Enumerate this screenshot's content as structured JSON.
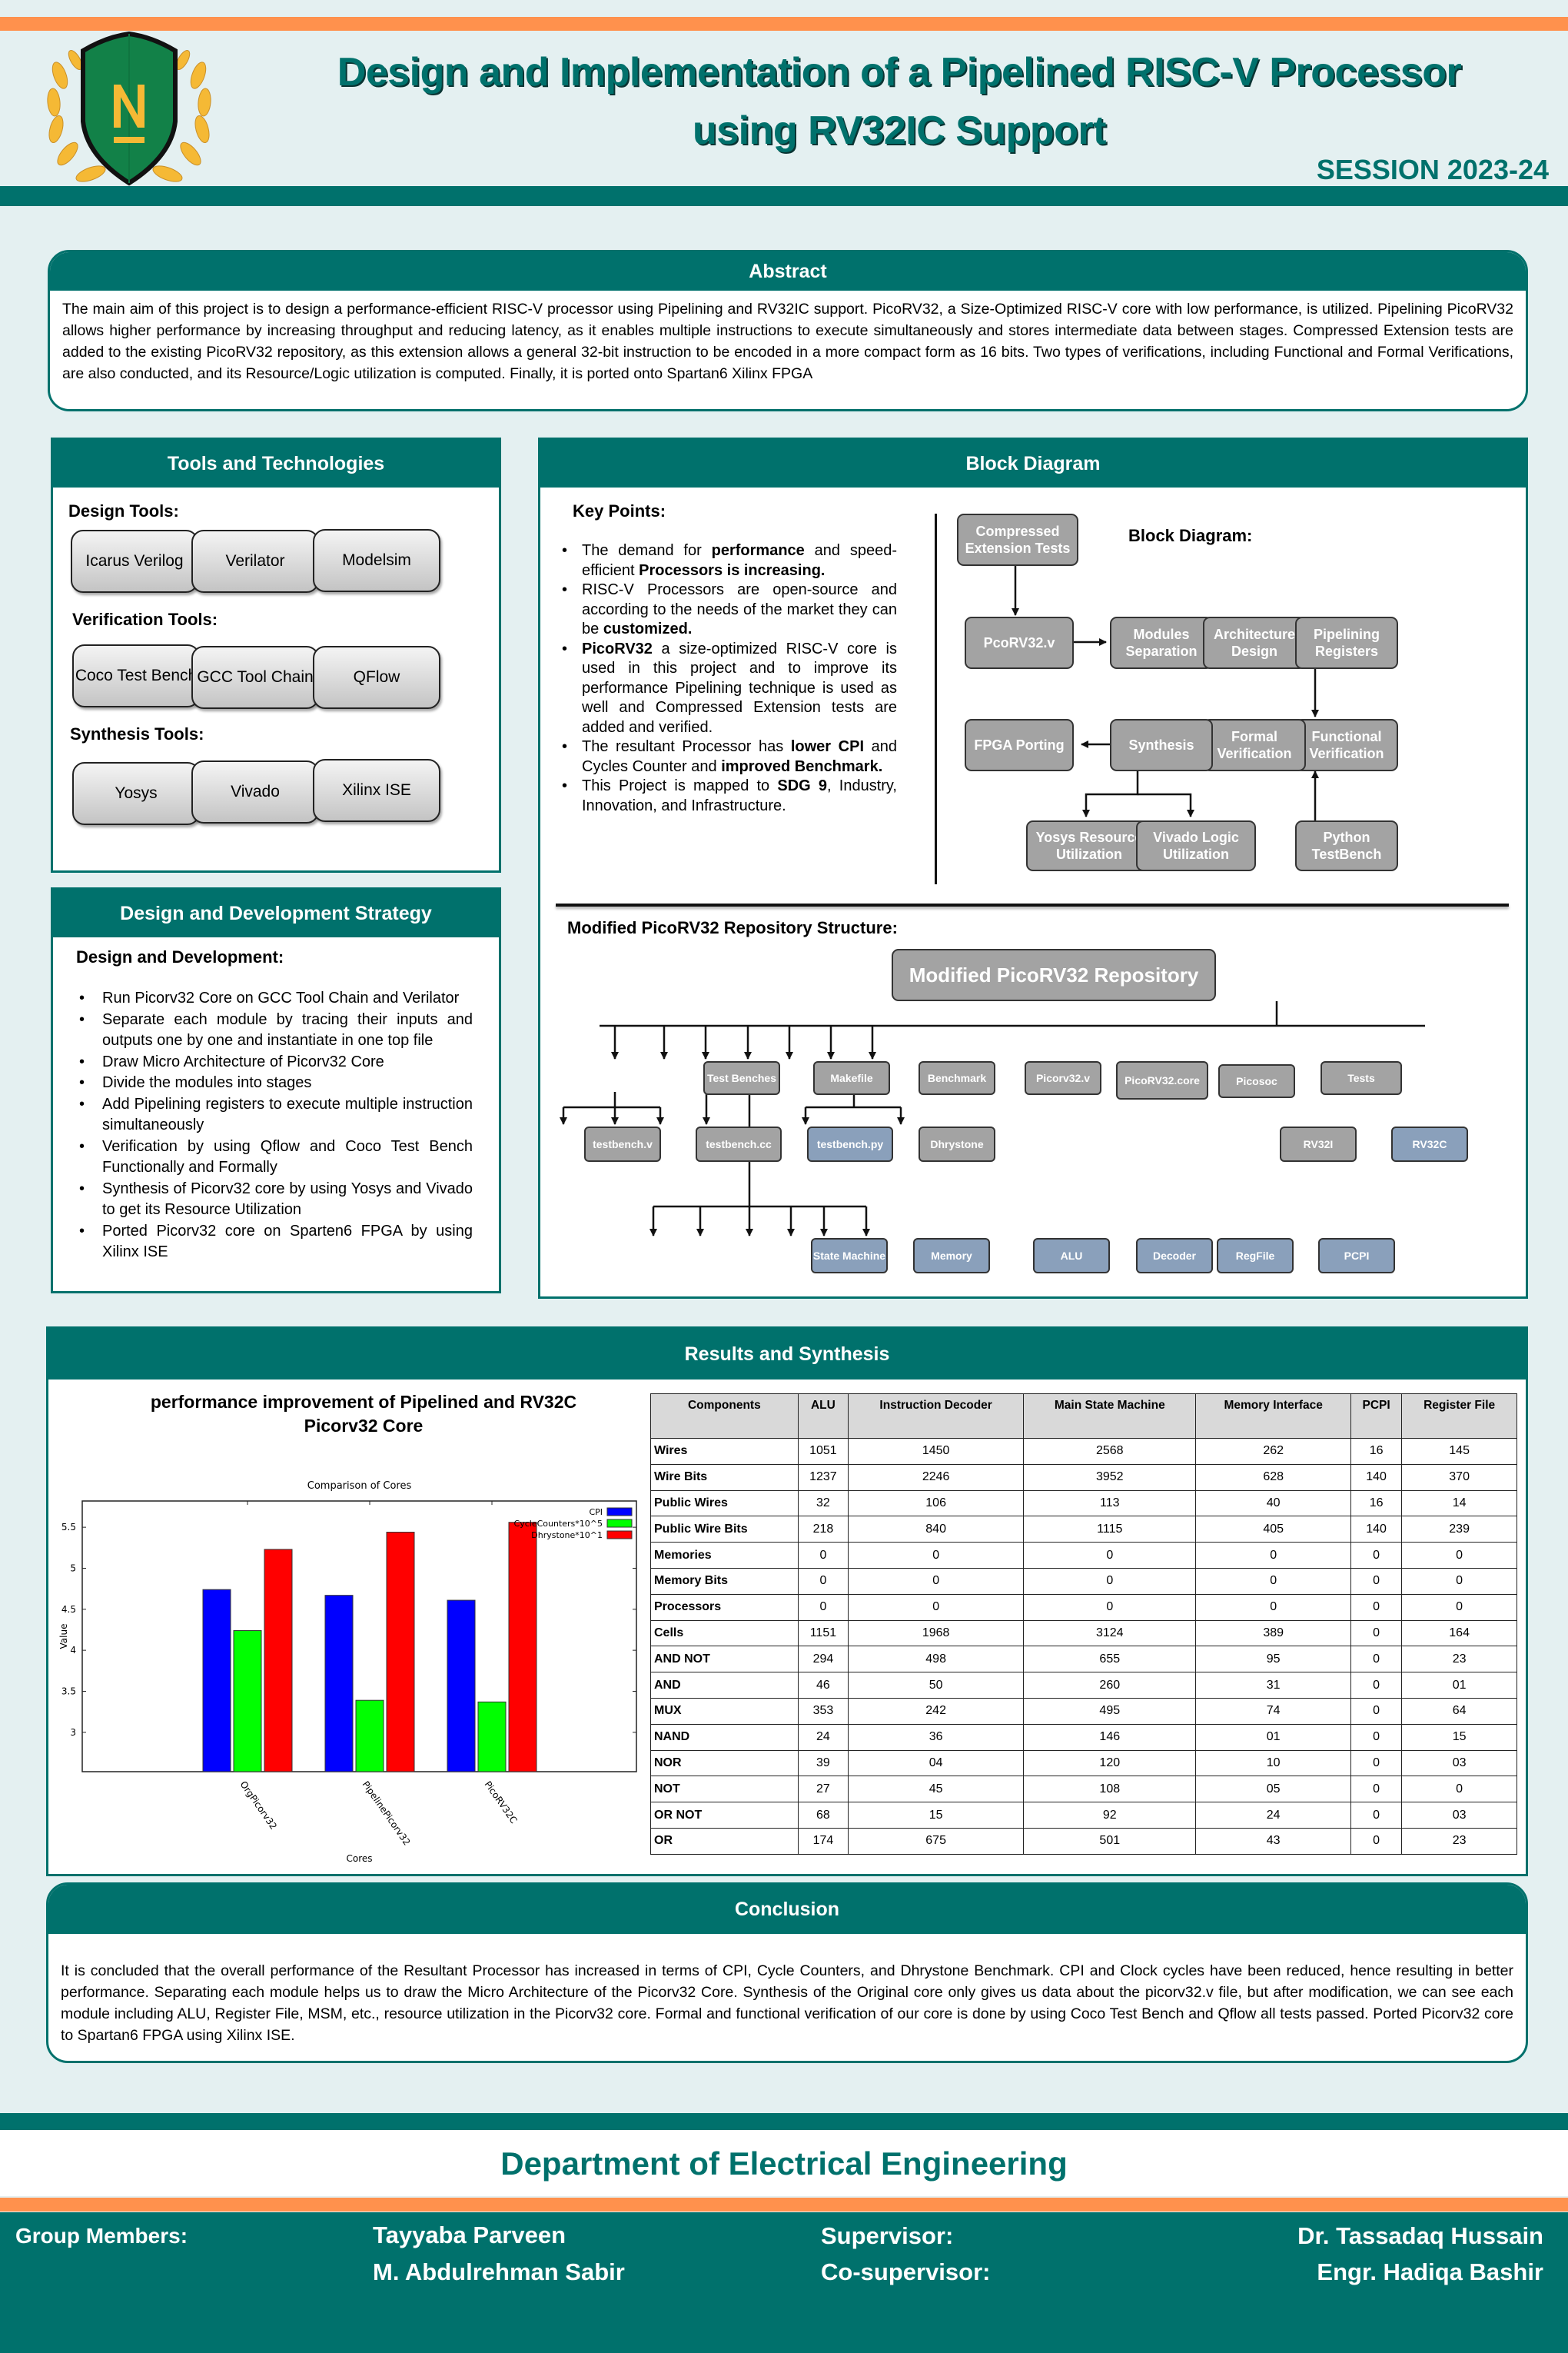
{
  "header": {
    "title_line1": "Design and Implementation of a Pipelined RISC-V Processor",
    "title_line2": "using RV32IC Support",
    "session": "SESSION 2023-24",
    "logo_letter": "N",
    "colors": {
      "primary": "#00716c",
      "accent": "#ff914d",
      "logo_green": "#128148",
      "logo_gold": "#f5b935"
    }
  },
  "abstract": {
    "heading": "Abstract",
    "text": "The main aim of this project is to design a performance-efficient RISC-V processor using Pipelining and RV32IC support. PicoRV32, a Size-Optimized RISC-V core with low performance, is utilized. Pipelining PicoRV32 allows higher performance by increasing throughput and reducing latency, as it enables multiple instructions to execute simultaneously and stores intermediate data between stages. Compressed Extension tests are added to the existing PicoRV32 repository, as this extension allows a general 32-bit instruction to be encoded in a more compact form as 16 bits. Two types of verifications, including Functional and Formal Verifications, are also conducted, and its Resource/Logic utilization is computed. Finally, it is ported onto Spartan6 Xilinx FPGA"
  },
  "tools": {
    "heading": "Tools and Technologies",
    "groups": [
      {
        "label": "Design Tools:",
        "items": [
          "Icarus Verilog",
          "Verilator",
          "Modelsim"
        ]
      },
      {
        "label": "Verification Tools:",
        "items": [
          "Coco Test Bench",
          "GCC Tool Chain",
          "QFlow"
        ]
      },
      {
        "label": "Synthesis Tools:",
        "items": [
          "Yosys",
          "Vivado",
          "Xilinx ISE"
        ]
      }
    ]
  },
  "strategy": {
    "heading": "Design and Development Strategy",
    "subheading": "Design and Development:",
    "items": [
      "Run Picorv32 Core on GCC Tool Chain and Verilator",
      "Separate each module by tracing their inputs and outputs one by one and instantiate in one top file",
      "Draw Micro Architecture of Picorv32 Core",
      "Divide the modules into stages",
      "Add Pipelining registers to execute multiple instruction simultaneously",
      "Verification by using Qflow and Coco Test Bench Functionally and Formally",
      "Synthesis of Picorv32 core by using Yosys and Vivado to get its Resource Utilization",
      "Ported Picorv32 core on Sparten6 FPGA by using Xilinx ISE"
    ]
  },
  "block": {
    "heading": "Block Diagram",
    "keypoints_title": "Key Points:",
    "keypoints": [
      [
        {
          "t": "The demand for "
        },
        {
          "t": "performance",
          "b": true
        },
        {
          "t": " and speed-efficient "
        },
        {
          "t": "Processors is increasing.",
          "b": true
        }
      ],
      [
        {
          "t": "RISC-V Processors are open-source and according to the needs of the market they can be "
        },
        {
          "t": "customized.",
          "b": true
        }
      ],
      [
        {
          "t": "PicoRV32",
          "b": true
        },
        {
          "t": " a size-optimized RISC-V core is used in this project and to improve its performance Pipelining technique is used as well and Compressed Extension tests are added and verified."
        }
      ],
      [
        {
          "t": "The resultant Processor has "
        },
        {
          "t": "lower CPI",
          "b": true
        },
        {
          "t": " and Cycles Counter and "
        },
        {
          "t": "improved Benchmark.",
          "b": true
        }
      ],
      [
        {
          "t": "This Project is mapped to "
        },
        {
          "t": "SDG 9",
          "b": true
        },
        {
          "t": ", Industry, Innovation, and Infrastructure."
        }
      ]
    ],
    "diagram_title": "Block Diagram:",
    "flow": {
      "compressed": "Compressed Extension Tests",
      "pcorv": "PcoRV32.v",
      "modules": "Modules Separation",
      "arch": "Architecture Design",
      "pipe": "Pipelining Registers",
      "func": "Functional Verification",
      "formal": "Formal Verification",
      "synth": "Synthesis",
      "fpga": "FPGA Porting",
      "yosys": "Yosys Resource Utilization",
      "vivado": "Vivado Logic Utilization",
      "python": "Python TestBench"
    },
    "repo_title": "Modified PicoRV32 Repository Structure:",
    "repo": {
      "root": "Modified PicoRV32 Repository",
      "children": [
        "Test Benches",
        "Makefile",
        "Benchmark",
        "Picorv32.v",
        "PicoRV32.core",
        "Picosoc",
        "Tests"
      ],
      "testbenches": [
        "testbench.v",
        "testbench.cc",
        "testbench.py"
      ],
      "benchmark": [
        "Dhrystone"
      ],
      "tests": [
        "RV32I",
        "RV32C"
      ],
      "modules": [
        "State Machine",
        "Memory",
        "ALU",
        "Decoder",
        "RegFile",
        "PCPI"
      ]
    }
  },
  "results": {
    "heading": "Results and Synthesis",
    "chart_heading_line1": "performance improvement of Pipelined and RV32C",
    "chart_heading_line2": "Picorv32 Core",
    "table": {
      "headers": [
        "Components",
        "ALU",
        "Instruction Decoder",
        "Main State Machine",
        "Memory Interface",
        "PCPI",
        "Register File"
      ],
      "rows": [
        [
          "Wires",
          "1051",
          "1450",
          "2568",
          "262",
          "16",
          "145"
        ],
        [
          "Wire Bits",
          "1237",
          "2246",
          "3952",
          "628",
          "140",
          "370"
        ],
        [
          "Public Wires",
          "32",
          "106",
          "113",
          "40",
          "16",
          "14"
        ],
        [
          "Public Wire Bits",
          "218",
          "840",
          "1115",
          "405",
          "140",
          "239"
        ],
        [
          "Memories",
          "0",
          "0",
          "0",
          "0",
          "0",
          "0"
        ],
        [
          "Memory Bits",
          "0",
          "0",
          "0",
          "0",
          "0",
          "0"
        ],
        [
          "Processors",
          "0",
          "0",
          "0",
          "0",
          "0",
          "0"
        ],
        [
          "Cells",
          "1151",
          "1968",
          "3124",
          "389",
          "0",
          "164"
        ],
        [
          "AND NOT",
          "294",
          "498",
          "655",
          "95",
          "0",
          "23"
        ],
        [
          "AND",
          "46",
          "50",
          "260",
          "31",
          "0",
          "01"
        ],
        [
          "MUX",
          "353",
          "242",
          "495",
          "74",
          "0",
          "64"
        ],
        [
          "NAND",
          "24",
          "36",
          "146",
          "01",
          "0",
          "15"
        ],
        [
          "NOR",
          "39",
          "04",
          "120",
          "10",
          "0",
          "03"
        ],
        [
          "NOT",
          "27",
          "45",
          "108",
          "05",
          "0",
          "0"
        ],
        [
          "OR NOT",
          "68",
          "15",
          "92",
          "24",
          "0",
          "03"
        ],
        [
          "OR",
          "174",
          "675",
          "501",
          "43",
          "0",
          "23"
        ]
      ]
    }
  },
  "chart_data": {
    "type": "bar",
    "title": "Comparison of Cores",
    "xlabel": "Cores",
    "ylabel": "Value",
    "categories": [
      "OrgPicorv32",
      "PipelinePicorv32",
      "PicoRV32C"
    ],
    "series": [
      {
        "name": "CPI",
        "color": "#0000ff",
        "values": [
          4.74,
          4.67,
          4.61
        ]
      },
      {
        "name": "CycleCounters*10^5",
        "color": "#00ff00",
        "values": [
          4.24,
          3.39,
          3.37
        ]
      },
      {
        "name": "Dhrystone*10^1",
        "color": "#ff0000",
        "values": [
          5.23,
          5.44,
          5.56
        ]
      }
    ],
    "yticks": [
      3,
      3.5,
      4,
      4.5,
      5,
      5.5
    ],
    "ytick_labels": [
      "3",
      "3.5",
      "4",
      "4.5",
      "5",
      "5.5"
    ],
    "ylim": [
      2.52,
      5.82
    ],
    "legend_position": "top-right",
    "grid": false
  },
  "conclusion": {
    "heading": "Conclusion",
    "text": "It is concluded that the overall performance of the Resultant Processor has increased in terms of CPI, Cycle Counters, and Dhrystone Benchmark. CPI and Clock cycles have been reduced, hence resulting in better performance. Separating each module helps us to draw the Micro Architecture of the Picorv32 Core. Synthesis of the Original core only gives us data about the picorv32.v file, but after modification, we can see each module including ALU, Register File, MSM, etc., resource utilization in the Picorv32 core. Formal and functional verification of our core is done by using Coco Test Bench and Qflow all tests passed. Ported Picorv32 core to Spartan6 FPGA using Xilinx ISE."
  },
  "footer": {
    "department": "Department of Electrical Engineering",
    "group_label": "Group Members:",
    "members": [
      "Tayyaba Parveen",
      "M. Abdulrehman Sabir"
    ],
    "supervisor_label": "Supervisor:",
    "supervisor": "Dr. Tassadaq Hussain",
    "cosupervisor_label": "Co-supervisor:",
    "cosupervisor": "Engr. Hadiqa Bashir"
  }
}
